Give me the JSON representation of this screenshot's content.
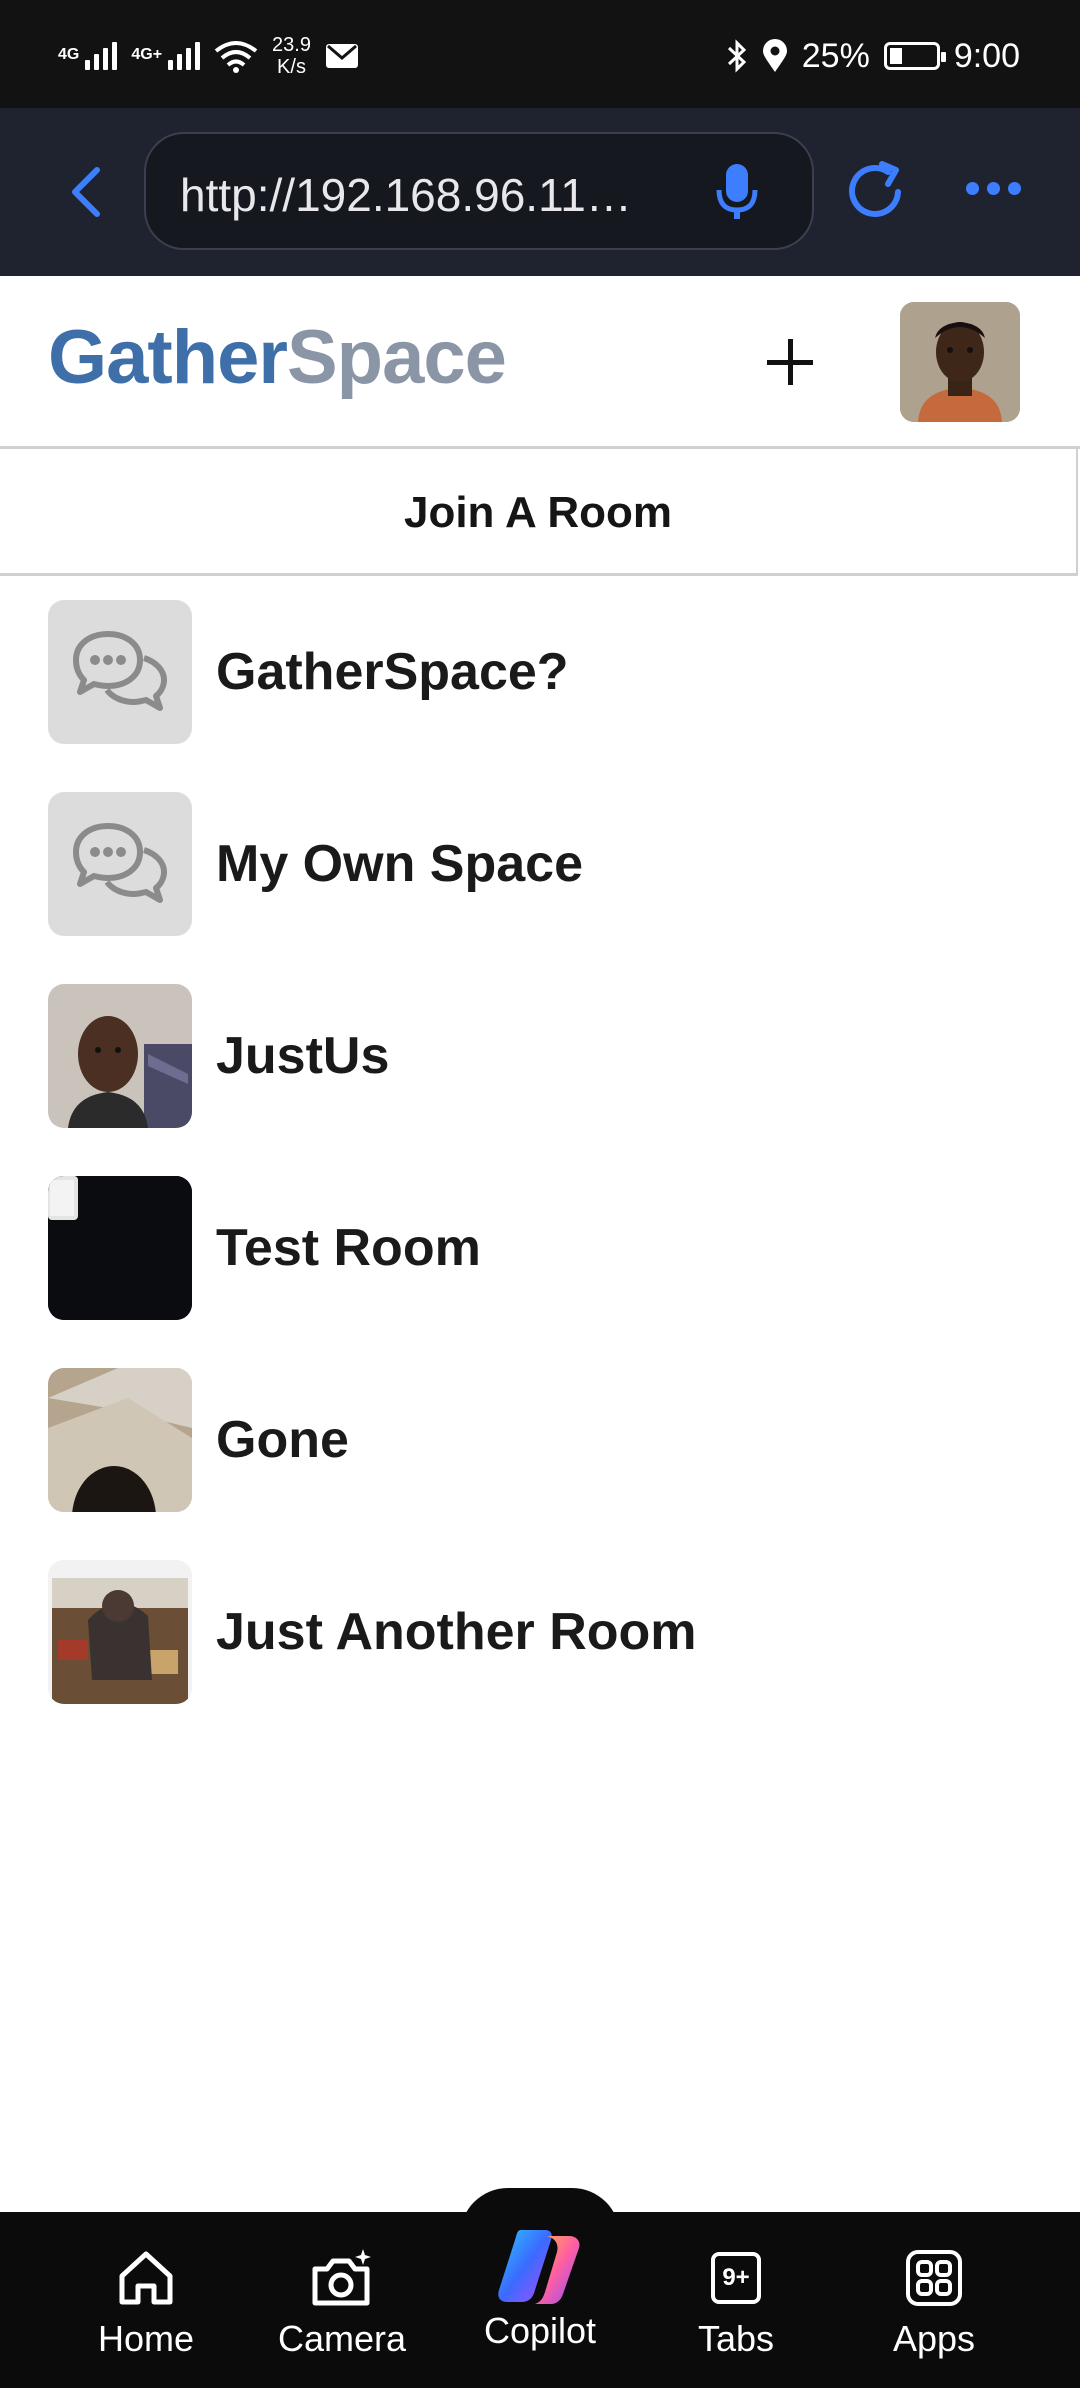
{
  "status_bar": {
    "signal1": "4G",
    "signal2": "4G+",
    "speed_value": "23.9",
    "speed_unit": "K/s",
    "battery": "25%",
    "time": "9:00"
  },
  "browser": {
    "url": "http://192.168.96.11…"
  },
  "header": {
    "logo_part1": "Gather",
    "logo_part2": "Space",
    "logo_color1": "#3f6fa8",
    "logo_color2": "#8a95a5"
  },
  "section": {
    "title": "Join A Room"
  },
  "rooms": [
    {
      "name": "GatherSpace?",
      "thumb": "chat-placeholder-icon"
    },
    {
      "name": "My Own Space",
      "thumb": "chat-placeholder-icon"
    },
    {
      "name": "JustUs",
      "thumb": "photo"
    },
    {
      "name": "Test Room",
      "thumb": "photo"
    },
    {
      "name": "Gone",
      "thumb": "photo"
    },
    {
      "name": "Just Another Room",
      "thumb": "photo"
    }
  ],
  "bottom_nav": [
    {
      "label": "Home",
      "icon": "home-icon"
    },
    {
      "label": "Camera",
      "icon": "camera-icon"
    },
    {
      "label": "Copilot",
      "icon": "copilot-icon"
    },
    {
      "label": "Tabs",
      "icon": "tabs-icon",
      "badge": "9+"
    },
    {
      "label": "Apps",
      "icon": "apps-icon"
    }
  ]
}
